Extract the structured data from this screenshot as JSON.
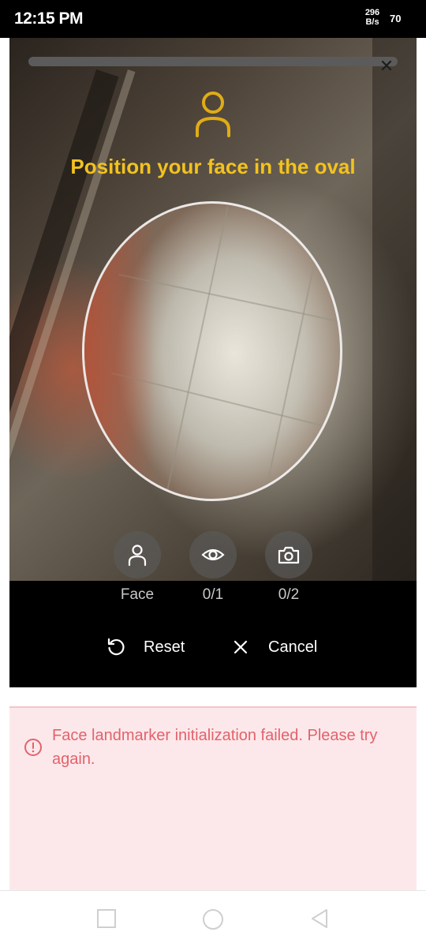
{
  "status_bar": {
    "time": "12:15 PM",
    "net_speed_value": "296",
    "net_speed_unit": "B/s",
    "battery": "70"
  },
  "camera": {
    "instruction": "Position your face in the oval",
    "close_icon": "close-icon",
    "top_icon": "person-icon",
    "accent_color": "#f2c21f"
  },
  "steps": [
    {
      "icon": "person-icon",
      "label": "Face"
    },
    {
      "icon": "eye-icon",
      "label": "0/1"
    },
    {
      "icon": "camera-icon",
      "label": "0/2"
    }
  ],
  "actions": {
    "reset_label": "Reset",
    "cancel_label": "Cancel"
  },
  "error": {
    "message": "Face landmarker initialization failed. Please try again.",
    "icon": "alert-circle-icon",
    "color": "#e3626b"
  },
  "nav": {
    "recents": "square-icon",
    "home": "circle-icon",
    "back": "triangle-back-icon"
  }
}
